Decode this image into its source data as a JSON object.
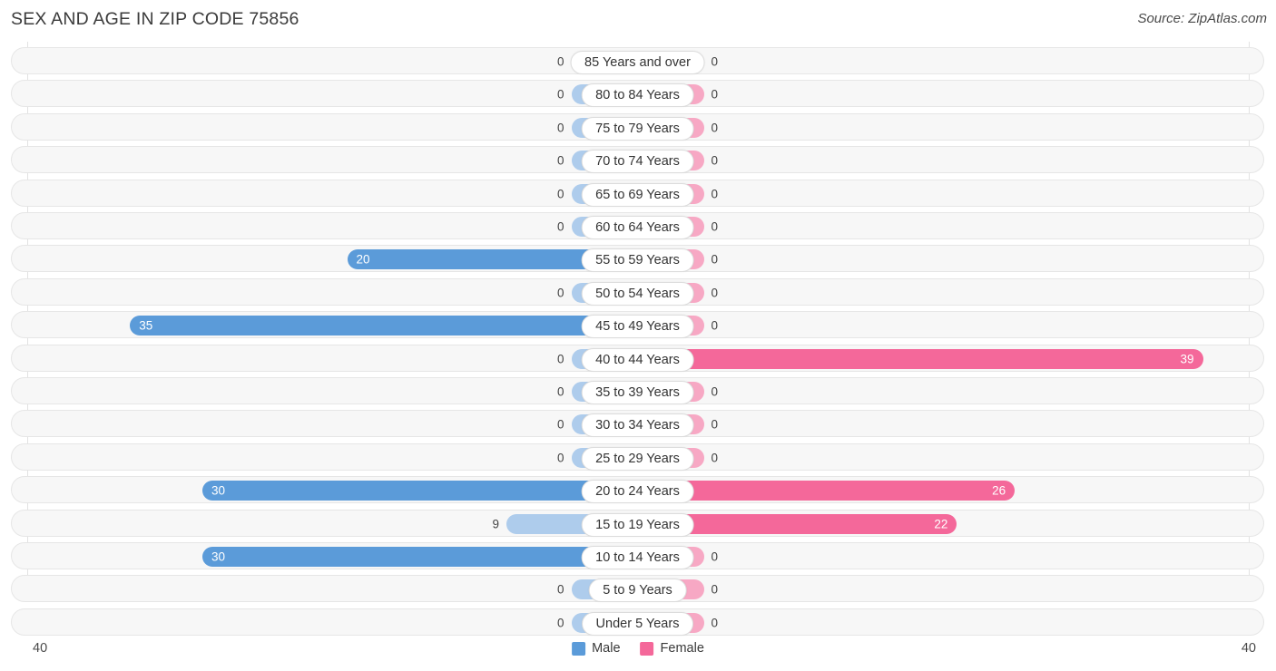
{
  "header": {
    "title": "SEX AND AGE IN ZIP CODE 75856",
    "source": "Source: ZipAtlas.com"
  },
  "legend": {
    "male_label": "Male",
    "female_label": "Female",
    "male_color": "#5B9BD9",
    "female_color": "#F4689A"
  },
  "axis": {
    "left_max": "40",
    "right_max": "40"
  },
  "colors": {
    "male_strong": "#5B9BD9",
    "male_light": "#AECCEC",
    "female_strong": "#F4689A",
    "female_light": "#F7A8C4",
    "row_track": "#f7f7f7",
    "row_border": "#e6e6e6"
  },
  "chart_data": {
    "type": "bar",
    "title": "SEX AND AGE IN ZIP CODE 75856",
    "xlabel": "",
    "ylabel": "",
    "orientation": "horizontal",
    "layout": "population-pyramid",
    "xlim": [
      0,
      40
    ],
    "grid": true,
    "legend_position": "bottom-center",
    "categories": [
      "85 Years and over",
      "80 to 84 Years",
      "75 to 79 Years",
      "70 to 74 Years",
      "65 to 69 Years",
      "60 to 64 Years",
      "55 to 59 Years",
      "50 to 54 Years",
      "45 to 49 Years",
      "40 to 44 Years",
      "35 to 39 Years",
      "30 to 34 Years",
      "25 to 29 Years",
      "20 to 24 Years",
      "15 to 19 Years",
      "10 to 14 Years",
      "5 to 9 Years",
      "Under 5 Years"
    ],
    "series": [
      {
        "name": "Male",
        "values": [
          0,
          0,
          0,
          0,
          0,
          0,
          20,
          0,
          35,
          0,
          0,
          0,
          0,
          30,
          9,
          30,
          0,
          0
        ]
      },
      {
        "name": "Female",
        "values": [
          0,
          0,
          0,
          0,
          0,
          0,
          0,
          0,
          0,
          39,
          0,
          0,
          0,
          26,
          22,
          0,
          0,
          0
        ]
      }
    ]
  },
  "rows": [
    {
      "age": "85 Years and over",
      "male": "0",
      "female": "0"
    },
    {
      "age": "80 to 84 Years",
      "male": "0",
      "female": "0"
    },
    {
      "age": "75 to 79 Years",
      "male": "0",
      "female": "0"
    },
    {
      "age": "70 to 74 Years",
      "male": "0",
      "female": "0"
    },
    {
      "age": "65 to 69 Years",
      "male": "0",
      "female": "0"
    },
    {
      "age": "60 to 64 Years",
      "male": "0",
      "female": "0"
    },
    {
      "age": "55 to 59 Years",
      "male": "20",
      "female": "0"
    },
    {
      "age": "50 to 54 Years",
      "male": "0",
      "female": "0"
    },
    {
      "age": "45 to 49 Years",
      "male": "35",
      "female": "0"
    },
    {
      "age": "40 to 44 Years",
      "male": "0",
      "female": "39"
    },
    {
      "age": "35 to 39 Years",
      "male": "0",
      "female": "0"
    },
    {
      "age": "30 to 34 Years",
      "male": "0",
      "female": "0"
    },
    {
      "age": "25 to 29 Years",
      "male": "0",
      "female": "0"
    },
    {
      "age": "20 to 24 Years",
      "male": "30",
      "female": "26"
    },
    {
      "age": "15 to 19 Years",
      "male": "9",
      "female": "22"
    },
    {
      "age": "10 to 14 Years",
      "male": "30",
      "female": "0"
    },
    {
      "age": "5 to 9 Years",
      "male": "0",
      "female": "0"
    },
    {
      "age": "Under 5 Years",
      "male": "0",
      "female": "0"
    }
  ]
}
